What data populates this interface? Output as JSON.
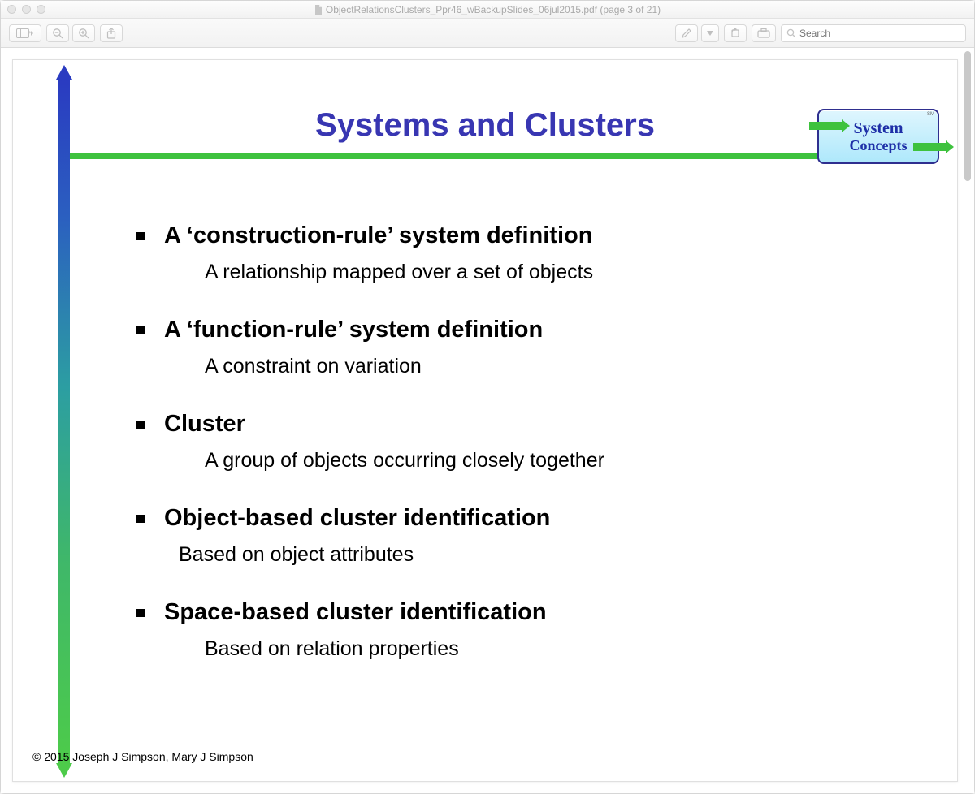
{
  "window": {
    "title": "ObjectRelationsClusters_Ppr46_wBackupSlides_06jul2015.pdf (page 3 of 21)"
  },
  "toolbar": {
    "search_placeholder": "Search"
  },
  "slide": {
    "title": "Systems and Clusters",
    "logo": {
      "line1": "System",
      "line2": "Concepts",
      "mark": "SM"
    },
    "items": [
      {
        "head": "A ‘construction-rule’ system definition",
        "sub": "A relationship mapped over a set of objects"
      },
      {
        "head": "A ‘function-rule’ system definition",
        "sub": "A constraint on variation"
      },
      {
        "head": "Cluster",
        "sub": "A group of objects occurring closely together"
      },
      {
        "head": "Object-based cluster identification",
        "sub": "Based on object attributes"
      },
      {
        "head": "Space-based cluster identification",
        "sub": "Based on relation properties"
      }
    ],
    "copyright": "© 2015  Joseph J Simpson, Mary J Simpson"
  }
}
